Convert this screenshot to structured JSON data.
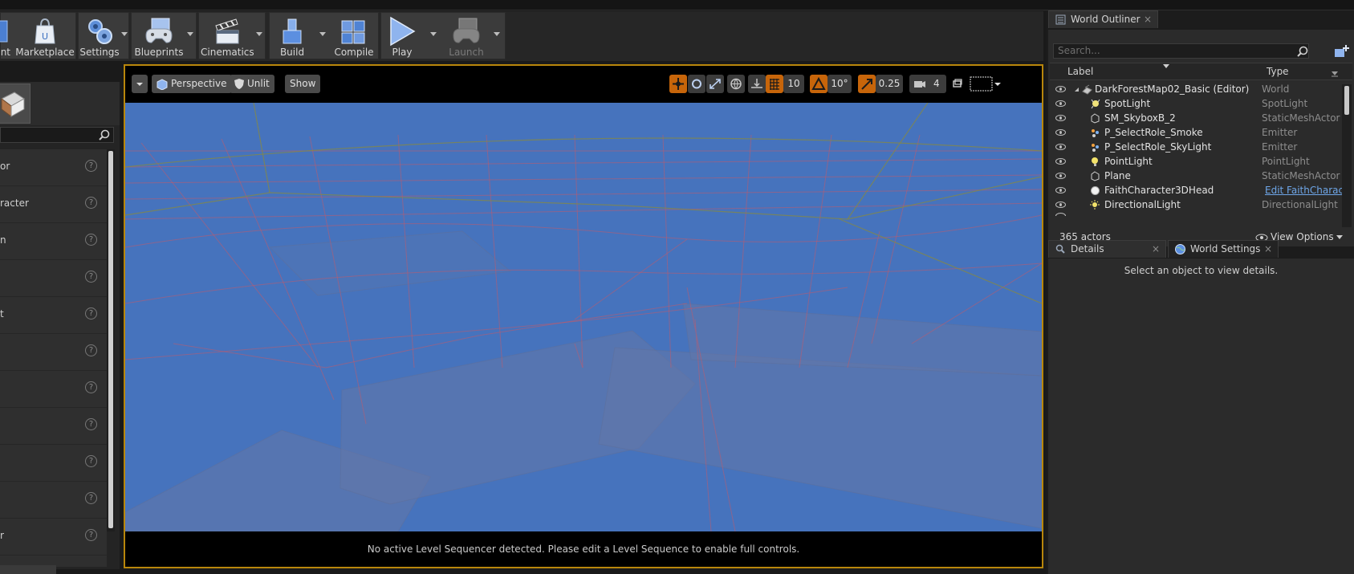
{
  "toolbar": {
    "buttons": [
      {
        "label": "nt",
        "icon": "content-icon"
      },
      {
        "label": "Marketplace",
        "icon": "marketplace-icon"
      },
      {
        "label": "Settings",
        "icon": "settings-gears-icon"
      },
      {
        "label": "Blueprints",
        "icon": "blueprints-gamepad-icon"
      },
      {
        "label": "Cinematics",
        "icon": "clapperboard-icon"
      },
      {
        "label": "Build",
        "icon": "build-blocks-icon"
      },
      {
        "label": "Compile",
        "icon": "compile-cubes-icon"
      },
      {
        "label": "Play",
        "icon": "play-icon"
      },
      {
        "label": "Launch",
        "icon": "launch-icon"
      }
    ]
  },
  "left_panel": {
    "items": [
      "or",
      "racter",
      "n",
      "",
      "t",
      "",
      "",
      "",
      "",
      "",
      "r"
    ],
    "help_glyph": "?"
  },
  "viewport": {
    "view_mode": "Perspective",
    "lighting": "Unlit",
    "show": "Show",
    "grid_snap": "10",
    "rotation_snap": "10°",
    "scale_snap": "0.25",
    "camera_speed": "4",
    "status": "No active Level Sequencer detected. Please edit a Level Sequence to enable full controls."
  },
  "outliner": {
    "tab_title": "World Outliner",
    "close_glyph": "×",
    "search_placeholder": "Search...",
    "col_label": "Label",
    "col_type": "Type",
    "rows": [
      {
        "label": "DarkForestMap02_Basic (Editor)",
        "type": "World",
        "icon": "world-icon"
      },
      {
        "label": "SpotLight",
        "type": "SpotLight",
        "icon": "spotlight-icon"
      },
      {
        "label": "SM_SkyboxB_2",
        "type": "StaticMeshActor",
        "icon": "static-mesh-icon"
      },
      {
        "label": "P_SelectRole_Smoke",
        "type": "Emitter",
        "icon": "emitter-icon"
      },
      {
        "label": "P_SelectRole_SkyLight",
        "type": "Emitter",
        "icon": "emitter-icon"
      },
      {
        "label": "PointLight",
        "type": "PointLight",
        "icon": "pointlight-icon"
      },
      {
        "label": "Plane",
        "type": "StaticMeshActor",
        "icon": "static-mesh-icon"
      },
      {
        "label": "FaithCharacter3DHead",
        "type": "Edit FaithCharac",
        "icon": "actor-sphere-icon"
      },
      {
        "label": "DirectionalLight",
        "type": "DirectionalLight",
        "icon": "directional-light-icon"
      }
    ],
    "actor_count": "365 actors",
    "view_options": "View Options"
  },
  "details": {
    "tab_title": "Details",
    "world_settings_tab": "World Settings",
    "empty_message": "Select an object to view details."
  },
  "colors": {
    "viewport_border": "#b8860b",
    "scene_sky": "#4673bd",
    "snap_orange": "#c7650a",
    "link_blue": "#6ea6e8"
  }
}
